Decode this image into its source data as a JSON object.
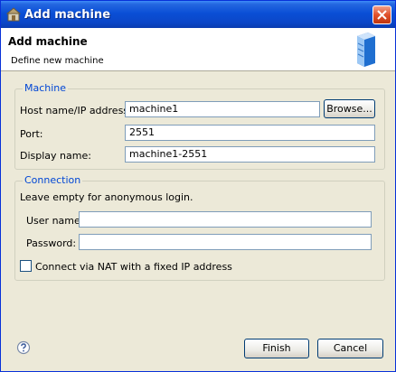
{
  "window": {
    "title": "Add machine"
  },
  "header": {
    "title": "Add machine",
    "subtitle": "Define new machine",
    "icon": "server-icon"
  },
  "machine_group": {
    "title": "Machine",
    "host": {
      "label": "Host name/IP address:",
      "value": "machine1"
    },
    "browse_label": "Browse...",
    "port": {
      "label": "Port:",
      "value": "2551"
    },
    "display": {
      "label": "Display name:",
      "value": "machine1-2551"
    }
  },
  "connection_group": {
    "title": "Connection",
    "note": "Leave empty for anonymous login.",
    "username": {
      "label": "User name:",
      "value": ""
    },
    "password": {
      "label": "Password:",
      "value": ""
    },
    "nat": {
      "label": "Connect via NAT with a fixed IP address",
      "checked": false
    }
  },
  "footer": {
    "finish_label": "Finish",
    "cancel_label": "Cancel"
  },
  "colors": {
    "titlebar": "#0a4fd6",
    "group_title": "#0046d5",
    "dialog_bg": "#ece9d8",
    "close_button": "#e0502a"
  }
}
